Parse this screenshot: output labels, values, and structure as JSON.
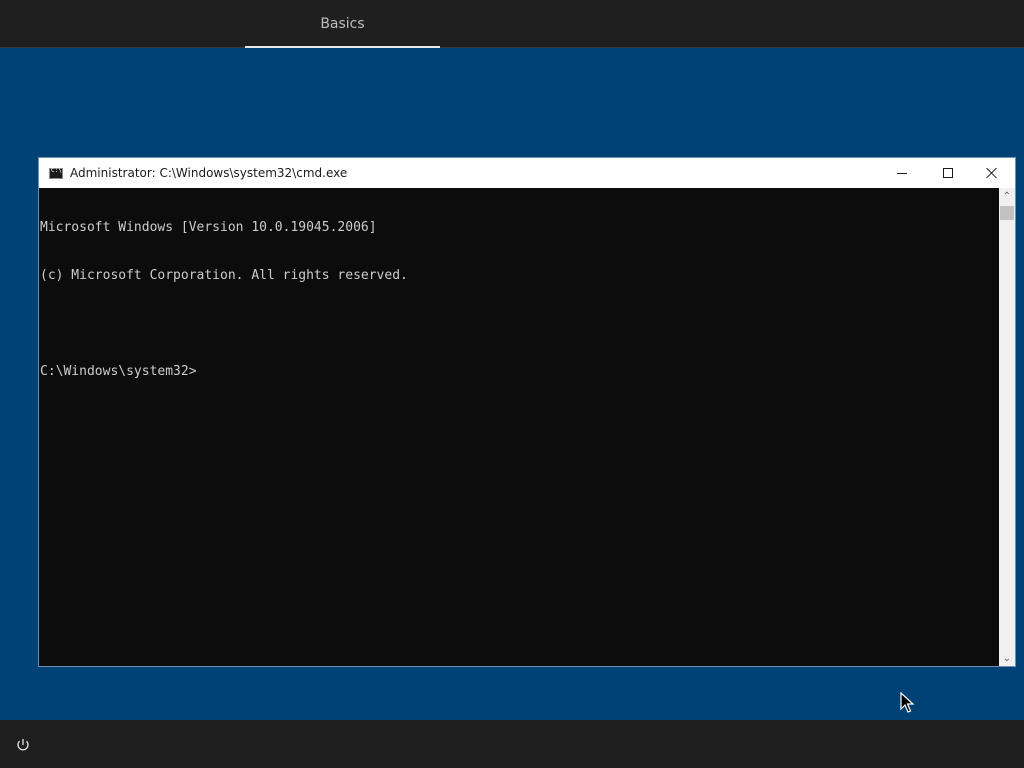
{
  "topbar": {
    "tab_label": "Basics"
  },
  "cmd_window": {
    "title": "Administrator: C:\\Windows\\system32\\cmd.exe",
    "lines": [
      "Microsoft Windows [Version 10.0.19045.2006]",
      "(c) Microsoft Corporation. All rights reserved.",
      "",
      "C:\\Windows\\system32>"
    ]
  },
  "bottombar": {
    "icon": "power-icon"
  },
  "colors": {
    "desktop": "#004275",
    "bars": "#1f1f1f",
    "console_bg": "#0c0c0c",
    "console_text": "#cccccc"
  }
}
